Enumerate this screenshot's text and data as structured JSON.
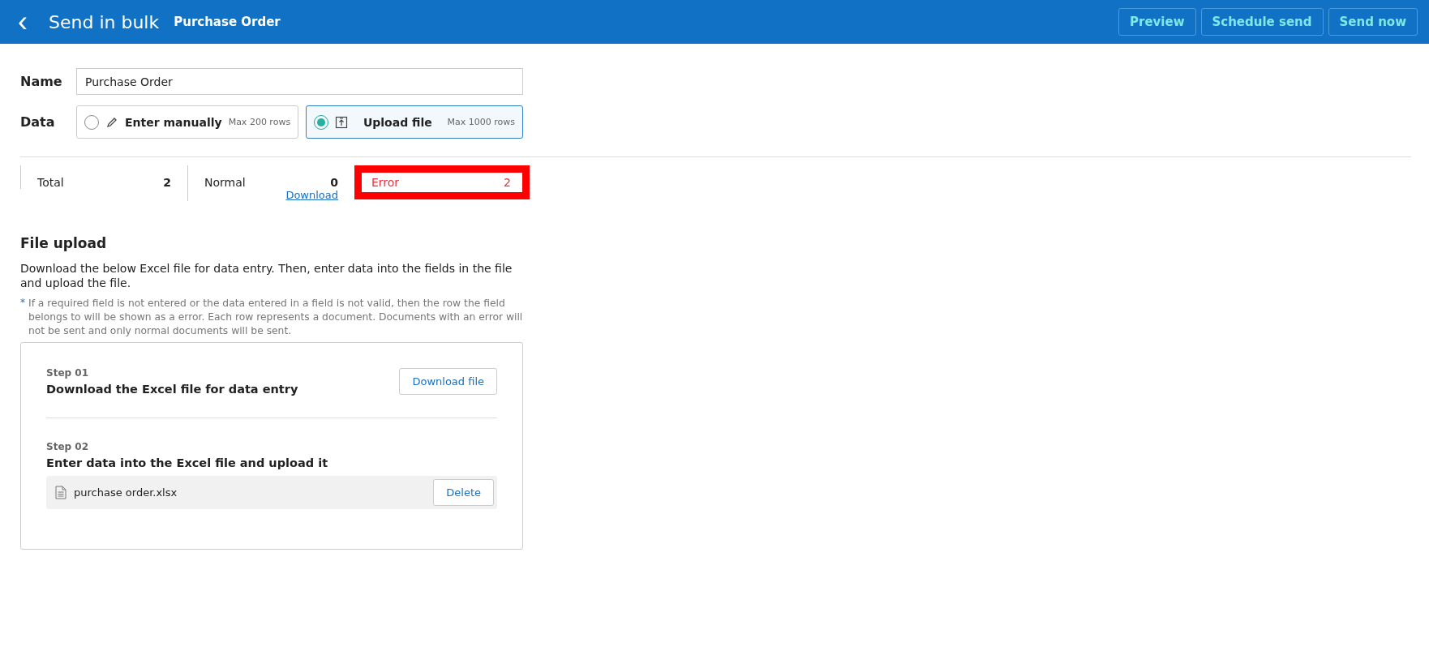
{
  "header": {
    "back": "‹",
    "title": "Send in bulk",
    "subtitle": "Purchase Order",
    "buttons": [
      "Preview",
      "Schedule send",
      "Send now"
    ]
  },
  "form": {
    "name_label": "Name",
    "name_value": "Purchase Order",
    "data_label": "Data",
    "options": [
      {
        "kind": "manual",
        "label": "Enter manually",
        "limit": "Max 200 rows",
        "selected": false
      },
      {
        "kind": "upload",
        "label": "Upload file",
        "limit": "Max 1000 rows",
        "selected": true
      }
    ]
  },
  "stats": [
    {
      "kind": "normal",
      "label": "Total",
      "value": "2",
      "highlighted": false
    },
    {
      "kind": "normal",
      "label": "Normal",
      "value": "0",
      "link": "Download",
      "highlighted": false
    },
    {
      "kind": "error",
      "label": "Error",
      "value": "2",
      "highlighted": true
    }
  ],
  "file_upload": {
    "title": "File upload",
    "description": "Download the below Excel file for data entry. Then, enter data into the fields in the file and upload the file.",
    "note_mark": "*",
    "note": "If a required field is not entered or the data entered in a field is not valid, then the row the field belongs to will be shown as a error. Each row represents a document. Documents with an error will not be sent and only normal documents will be sent.",
    "steps": [
      {
        "kind": "download",
        "step": "Step 01",
        "title": "Download the Excel file for data entry",
        "button": "Download file"
      },
      {
        "kind": "upload",
        "step": "Step 02",
        "title": "Enter data into the Excel file and upload it",
        "file_name": "purchase order.xlsx",
        "button": "Delete"
      }
    ]
  }
}
